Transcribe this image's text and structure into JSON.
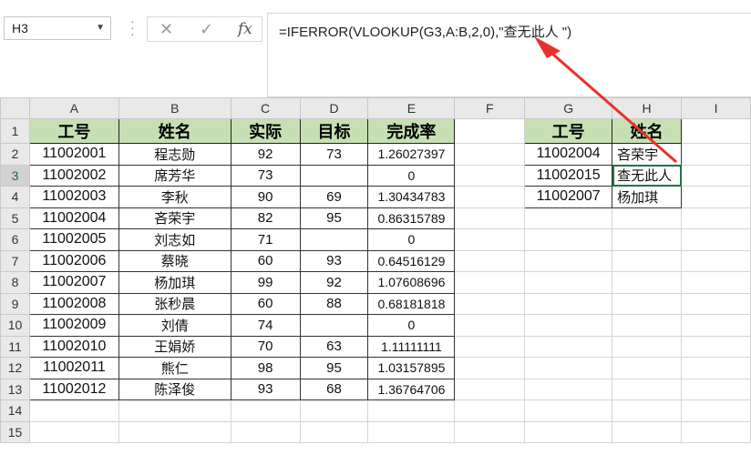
{
  "name_box": {
    "value": "H3"
  },
  "formula_bar": {
    "cancel_glyph": "✕",
    "enter_glyph": "✓",
    "fx_label": "fx",
    "formula": "=IFERROR(VLOOKUP(G3,A:B,2,0),\"查无此人 \")"
  },
  "columns": [
    "A",
    "B",
    "C",
    "D",
    "E",
    "F",
    "G",
    "H",
    "I"
  ],
  "rows": [
    "1",
    "2",
    "3",
    "4",
    "5",
    "6",
    "7",
    "8",
    "9",
    "10",
    "11",
    "12",
    "13",
    "14",
    "15"
  ],
  "main_table": {
    "headers": [
      "工号",
      "姓名",
      "实际",
      "目标",
      "完成率"
    ],
    "rows": [
      [
        "11002001",
        "程志勋",
        "92",
        "73",
        "1.26027397"
      ],
      [
        "11002002",
        "席芳华",
        "73",
        "",
        "0"
      ],
      [
        "11002003",
        "李秋",
        "90",
        "69",
        "1.30434783"
      ],
      [
        "11002004",
        "吝荣宇",
        "82",
        "95",
        "0.86315789"
      ],
      [
        "11002005",
        "刘志如",
        "71",
        "",
        "0"
      ],
      [
        "11002006",
        "蔡晓",
        "60",
        "93",
        "0.64516129"
      ],
      [
        "11002007",
        "杨加琪",
        "99",
        "92",
        "1.07608696"
      ],
      [
        "11002008",
        "张秒晨",
        "60",
        "88",
        "0.68181818"
      ],
      [
        "11002009",
        "刘倩",
        "74",
        "",
        "0"
      ],
      [
        "11002010",
        "王娟娇",
        "70",
        "63",
        "1.11111111"
      ],
      [
        "11002011",
        "熊仁",
        "98",
        "95",
        "1.03157895"
      ],
      [
        "11002012",
        "陈泽俊",
        "93",
        "68",
        "1.36764706"
      ]
    ]
  },
  "lookup_table": {
    "headers": [
      "工号",
      "姓名"
    ],
    "rows": [
      [
        "11002004",
        "吝荣宇"
      ],
      [
        "11002015",
        "查无此人"
      ],
      [
        "11002007",
        "杨加琪"
      ]
    ]
  },
  "colors": {
    "header_fill": "#c6e0b4",
    "selection": "#217346",
    "arrow": "#e8322b"
  }
}
